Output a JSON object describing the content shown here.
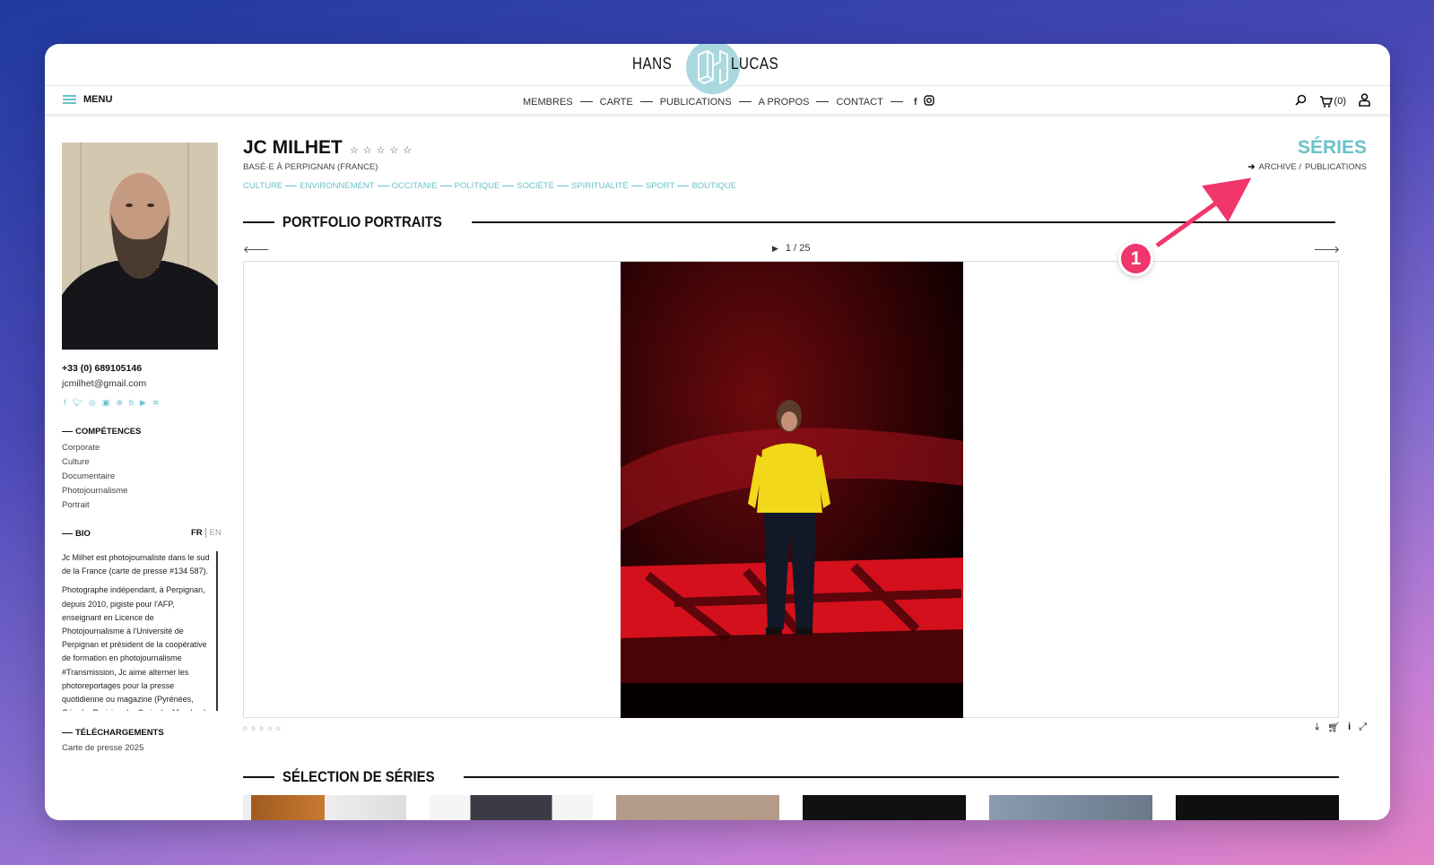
{
  "header": {
    "logo_left": "HANS",
    "logo_right": "LUCAS",
    "menu_label": "MENU",
    "nav": [
      "MEMBRES",
      "CARTE",
      "PUBLICATIONS",
      "A PROPOS",
      "CONTACT"
    ],
    "cart_count": "(0)"
  },
  "sidebar": {
    "phone": "+33 (0) 689105146",
    "email": "jcmilhet@gmail.com",
    "social_icons": [
      "facebook-icon",
      "twitter-icon",
      "instagram-icon",
      "linkedin-icon",
      "globe-icon",
      "behance-icon",
      "youtube-icon",
      "rss-icon"
    ],
    "skills_title": "COMPÉTENCES",
    "skills": [
      "Corporate",
      "Culture",
      "Documentaire",
      "Photojournalisme",
      "Portrait"
    ],
    "bio_title": "BIO",
    "lang_fr": "FR",
    "lang_en": "EN",
    "bio_p1": "Jc Milhet est photojournaliste dans le sud de la France (carte de presse #134 587).",
    "bio_p2": "Photographe indépendant, à Perpignan, depuis 2010, pigiste pour l'AFP, enseignant en Licence de Photojournalisme à l'Université de Perpignan et président de la coopérative de formation en photojournalisme #Transmission, Jc aime alterner les photoreportages pour la presse quotidienne ou magazine (Pyrénées, Géo, Le Parisien, La Croix, Le Monde...) et la",
    "downloads_title": "TÉLÉCHARGEMENTS",
    "download_link": "Carte de presse 2025"
  },
  "author": {
    "name": "JC MILHET",
    "based": "BASÉ·E À PERPIGNAN (FRANCE)",
    "tags": [
      "CULTURE",
      "ENVIRONNEMENT",
      "OCCITANIE",
      "POLITIQUE",
      "SOCIÉTÉ",
      "SPIRITUALITÉ",
      "SPORT",
      "BOUTIQUE"
    ]
  },
  "series_nav": {
    "title": "SÉRIES",
    "archive": "ARCHIVE /",
    "publications": "PUBLICATIONS"
  },
  "portfolio": {
    "title": "PORTFOLIO PORTRAITS",
    "counter": "1 / 25"
  },
  "selection": {
    "title": "SÉLECTION DE SÉRIES"
  },
  "annotation": {
    "badge": "1"
  },
  "colors": {
    "accent": "#6bc1c9",
    "badge": "#f0366b"
  }
}
